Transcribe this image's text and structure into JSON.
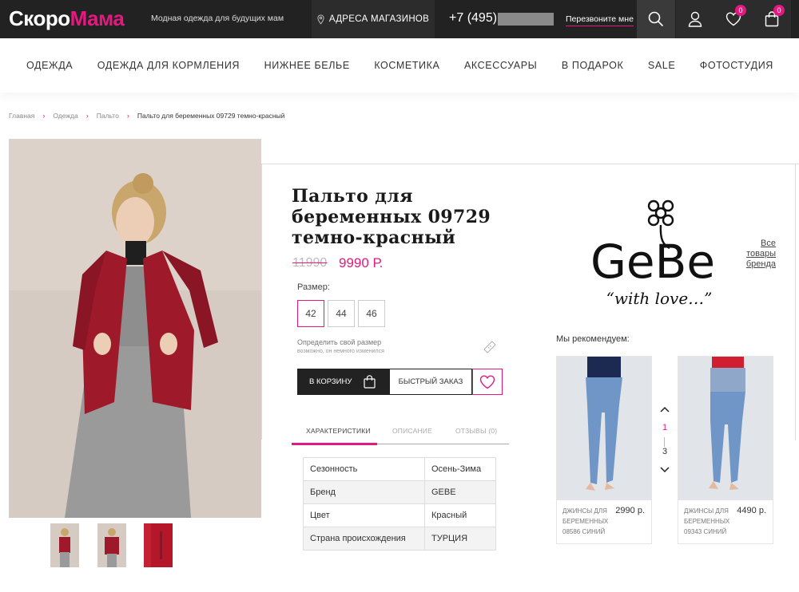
{
  "header": {
    "logo_part1": "Скоро",
    "logo_part2": "Мама",
    "tagline": "Модная одежда для будущих мам",
    "stores_label": "АДРЕСА МАГАЗИНОВ",
    "phone_prefix": "+7 (495)",
    "callback_label": "Перезвоните мне",
    "favorites_count": "0",
    "cart_count": "0"
  },
  "nav": [
    "ОДЕЖДА",
    "ОДЕЖДА ДЛЯ КОРМЛЕНИЯ",
    "НИЖНЕЕ БЕЛЬЕ",
    "КОСМЕТИКА",
    "АКСЕССУАРЫ",
    "В ПОДАРОК",
    "SALE",
    "ФОТОСТУДИЯ"
  ],
  "breadcrumb": [
    "Главная",
    "Одежда",
    "Пальто",
    "Пальто для беременных 09729 темно-красный"
  ],
  "product": {
    "title": "Пальто для беременных 09729 темно-красный",
    "old_price": "11990",
    "new_price": "9990 Р.",
    "size_label": "Размер:",
    "sizes": [
      "42",
      "44",
      "46"
    ],
    "selected_size": "42",
    "define_size": "Определить свой размер",
    "define_size_hint": "возможно, он немного изменился",
    "add_to_cart": "В КОРЗИНУ",
    "quick_order": "БЫСТРЫЙ ЗАКАЗ",
    "tabs": [
      "ХАРАКТЕРИСТИКИ",
      "ОПИСАНИЕ",
      "ОТЗЫВЫ (0)"
    ],
    "specs": [
      {
        "key": "Сезонность",
        "value": "Осень-Зима"
      },
      {
        "key": "Бренд",
        "value": "GEBE"
      },
      {
        "key": "Цвет",
        "value": "Красный"
      },
      {
        "key": "Страна происхождения",
        "value": "ТУРЦИЯ"
      }
    ]
  },
  "brand": {
    "logo_text": "GeBe",
    "slogan": "“with love…”",
    "all_products_link": "Все товары бренда"
  },
  "recommend": {
    "title": "Мы рекомендуем:",
    "items": [
      {
        "name": "ДЖИНСЫ ДЛЯ БЕРЕМЕННЫХ 08586 СИНИЙ",
        "price": "2990 р."
      },
      {
        "name": "ДЖИНСЫ ДЛЯ БЕРЕМЕННЫХ 09343 СИНИЙ",
        "price": "4490 р."
      }
    ],
    "page_current": "1",
    "page_total": "3"
  },
  "colors": {
    "accent": "#e5187f",
    "topbar": "#222222",
    "coat": "#9e1a2b"
  }
}
